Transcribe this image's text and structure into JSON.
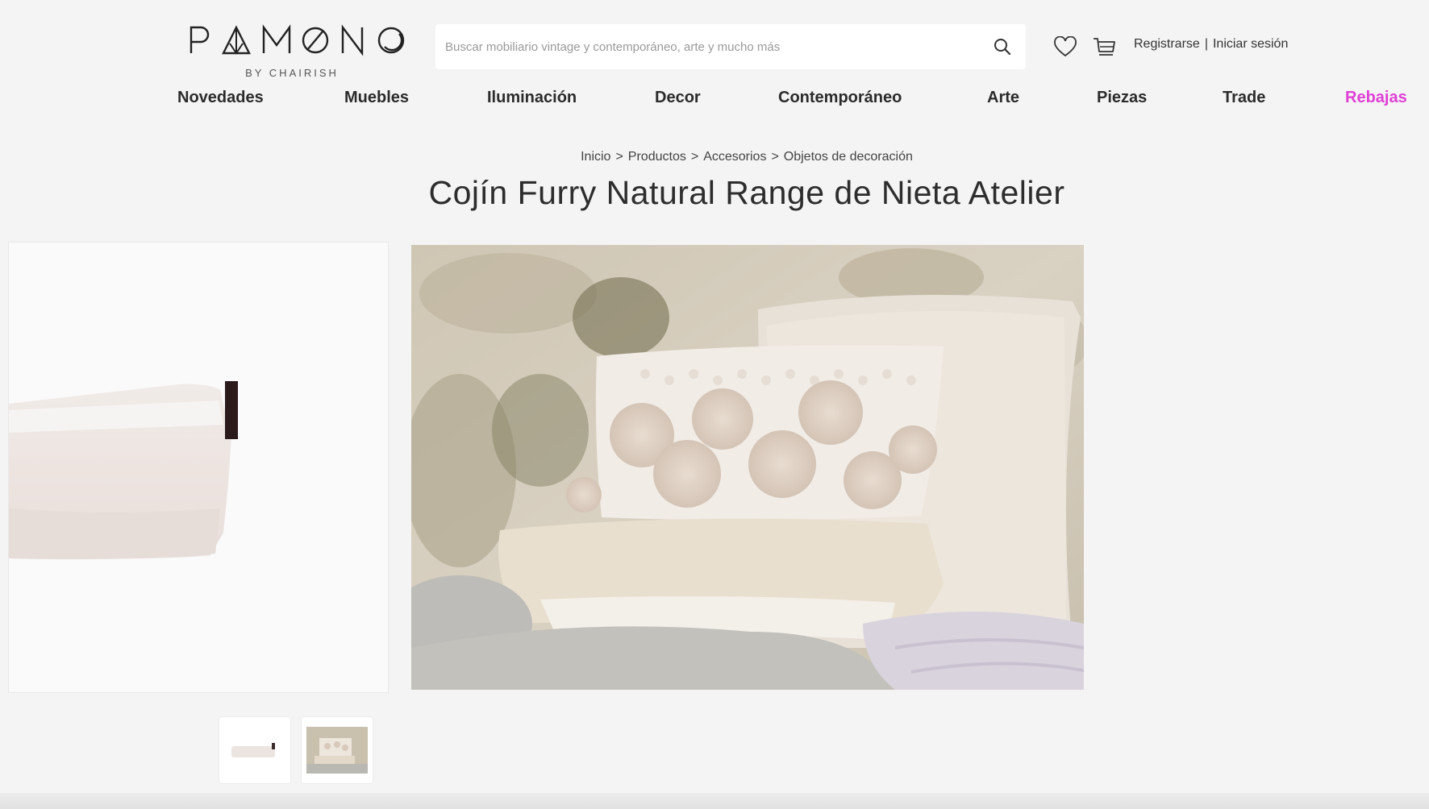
{
  "brand": {
    "logo_text": "PAMONO",
    "logo_sub": "BY CHAIRISH"
  },
  "search": {
    "placeholder": "Buscar mobiliario vintage y contemporáneo, arte y mucho más",
    "icon": "search-icon"
  },
  "header": {
    "wishlist_icon": "heart-icon",
    "cart_icon": "cart-icon",
    "register_label": "Registrarse",
    "separator": "|",
    "login_label": "Iniciar sesión"
  },
  "nav": {
    "items": [
      {
        "label": "Novedades"
      },
      {
        "label": "Muebles"
      },
      {
        "label": "Iluminación"
      },
      {
        "label": "Decor"
      },
      {
        "label": "Contemporáneo"
      },
      {
        "label": "Arte"
      },
      {
        "label": "Piezas"
      },
      {
        "label": "Trade"
      },
      {
        "label": "Rebajas"
      }
    ],
    "sale_color": "#e03fd6"
  },
  "breadcrumb": {
    "items": [
      "Inicio",
      "Productos",
      "Accesorios",
      "Objetos de decoración"
    ],
    "separator": ">"
  },
  "product": {
    "title": "Cojín Furry Natural Range de Nieta Atelier"
  },
  "gallery": {
    "thumbnail_count": 2,
    "active_thumbnail": 2
  }
}
